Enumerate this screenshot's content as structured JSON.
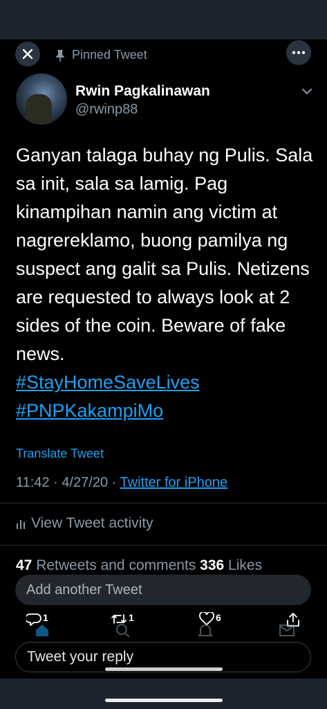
{
  "header": {
    "pinned_label": "Pinned Tweet",
    "close_icon": "close-icon",
    "more_icon": "more-icon"
  },
  "author": {
    "display_name": "Rwin Pagkalinawan",
    "handle": "@rwinp88"
  },
  "tweet": {
    "text": "Ganyan talaga buhay ng Pulis. Sala sa init, sala sa lamig. Pag kinampihan namin ang victim at nagrereklamo, buong pamilya ng suspect ang galit sa Pulis. Netizens are requested to always look at 2 sides of the coin. Beware of fake news.",
    "hashtags": [
      "#StayHomeSaveLives",
      "#PNPKakampiMo"
    ],
    "translate_label": "Translate Tweet",
    "time": "11:42",
    "date": "4/27/20",
    "separator": "·",
    "source": "Twitter for iPhone"
  },
  "activity_label": "View Tweet activity",
  "stats": {
    "retweets_count": "47",
    "retweets_label": "Retweets and comments",
    "likes_count": "336",
    "likes_label": "Likes"
  },
  "composer": {
    "add_another_placeholder": "Add another Tweet",
    "reply_placeholder": "Tweet your reply"
  },
  "actions": {
    "reply_count": "1",
    "retweet_count": "1",
    "like_count": "6"
  },
  "colors": {
    "background": "#000000",
    "accent": "#1da1f2",
    "secondary_text": "#8899a6"
  }
}
